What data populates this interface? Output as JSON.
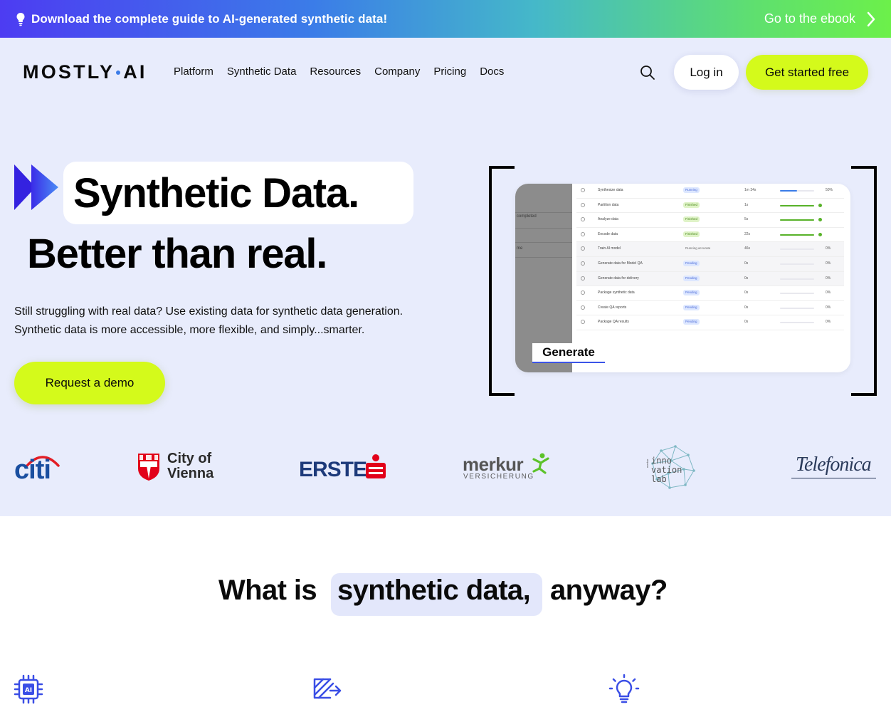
{
  "banner": {
    "text": "Download the complete guide to AI-generated synthetic data!",
    "link": "Go to the ebook",
    "icons": [
      "lightbulb-icon",
      "chevron-right-icon"
    ],
    "gradient": [
      "#4d3cf2",
      "#3b7ce8",
      "#5fe06e",
      "#6cf04a"
    ]
  },
  "header": {
    "logo": {
      "left": "MOSTLY",
      "right": "AI"
    },
    "nav": [
      "Platform",
      "Synthetic Data",
      "Resources",
      "Company",
      "Pricing",
      "Docs"
    ],
    "login": "Log in",
    "cta": "Get started free"
  },
  "hero": {
    "headline_1": "Synthetic Data.",
    "headline_2": "Better than real.",
    "subtitle_1": "Still struggling with real data? Use existing data for synthetic data generation.",
    "subtitle_2": "Synthetic data is more accessible, more flexible, and simply...smarter.",
    "demo_button": "Request a demo",
    "background": "#e8ecfc",
    "accent": "#d4fa1b"
  },
  "preview": {
    "side_labels": [
      "completed",
      "me"
    ],
    "rows": [
      {
        "name": "Synthesize data",
        "status": "Running",
        "status_kind": "running",
        "duration": "1m 34s",
        "progress": 0.5,
        "percent": "50%"
      },
      {
        "name": "Partition data",
        "status": "Finished",
        "status_kind": "finished",
        "duration": "1s",
        "progress": 1.0,
        "percent": ""
      },
      {
        "name": "Analyze data",
        "status": "Finished",
        "status_kind": "finished",
        "duration": "5s",
        "progress": 1.0,
        "percent": ""
      },
      {
        "name": "Encode data",
        "status": "Finished",
        "status_kind": "finished",
        "duration": "22s",
        "progress": 1.0,
        "percent": ""
      },
      {
        "name": "Train AI model",
        "status": "Running accurate",
        "status_kind": "plain",
        "duration": "46s",
        "progress": 0,
        "percent": "0%"
      },
      {
        "name": "Generate data for Model QA",
        "status": "Pending",
        "status_kind": "pending",
        "duration": "0s",
        "progress": 0,
        "percent": "0%"
      },
      {
        "name": "Generate data for delivery",
        "status": "Pending",
        "status_kind": "pending",
        "duration": "0s",
        "progress": 0,
        "percent": "0%"
      },
      {
        "name": "Package synthetic data",
        "status": "Pending",
        "status_kind": "pending",
        "duration": "0s",
        "progress": 0,
        "percent": "0%"
      },
      {
        "name": "Create QA reports",
        "status": "Pending",
        "status_kind": "pending",
        "duration": "0s",
        "progress": 0,
        "percent": "0%"
      },
      {
        "name": "Package QA results",
        "status": "Pending",
        "status_kind": "pending",
        "duration": "0s",
        "progress": 0,
        "percent": "0%"
      }
    ],
    "generate_label": "Generate"
  },
  "clients": {
    "citi": "citi",
    "vienna_1": "City of",
    "vienna_2": "Vienna",
    "erste": "ERSTE",
    "merkur": "merkur",
    "merkur_sub": "VERSICHERUNG",
    "innov_1": "inno",
    "innov_2": "vation",
    "innov_3": "lab",
    "innov_side": "merkur",
    "telefonica": "Telefonica"
  },
  "whatis": {
    "part_a": "What is",
    "part_b": "synthetic data,",
    "part_c": "anyway?"
  },
  "features": {
    "icons": [
      "ai-chip-icon",
      "data-transform-icon",
      "lightbulb-icon"
    ]
  }
}
